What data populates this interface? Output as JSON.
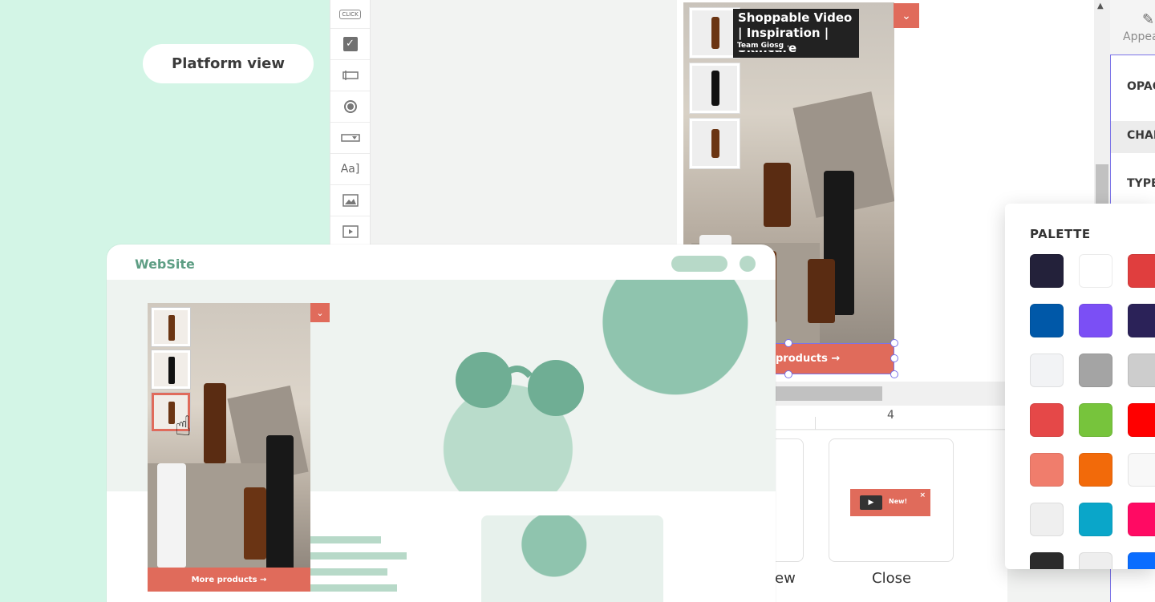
{
  "platform_view_label": "Platform view",
  "tools": [
    "CLICK",
    "checkbox",
    "input",
    "radio",
    "dropdown",
    "text",
    "image",
    "video"
  ],
  "editor": {
    "video_title": "Shoppable Video | Inspiration | Skincare",
    "video_subtitle": "Team Giosg",
    "cta_label": "products →",
    "timeline_number": "4"
  },
  "right_panel": {
    "tab_label": "Appea",
    "rows": [
      "OPAC",
      "CHAR",
      "TYPE"
    ]
  },
  "palette": {
    "title": "PALETTE",
    "swatches": [
      [
        "#23213a",
        "#ffffff",
        "#e03e3e"
      ],
      [
        "#0058a8",
        "#7b4ff5",
        "#2b2258"
      ],
      [
        "#f2f3f5",
        "#a4a4a4",
        "#cdcdcd"
      ],
      [
        "#e54848",
        "#77c43c",
        "#ff0000"
      ],
      [
        "#f07d6c",
        "#f26a0a",
        "#f8f8f8"
      ],
      [
        "#efefef",
        "#0aa6c9",
        "#ff0a63"
      ],
      [
        "#2b2b2b",
        "#eeeeee",
        "#0a6dff"
      ]
    ]
  },
  "cards": {
    "left_label": "ew",
    "close_label": "Close",
    "mini_new": "New!",
    "mini_close": "×"
  },
  "website": {
    "brand": "WebSite",
    "cta_label": "More products →"
  }
}
